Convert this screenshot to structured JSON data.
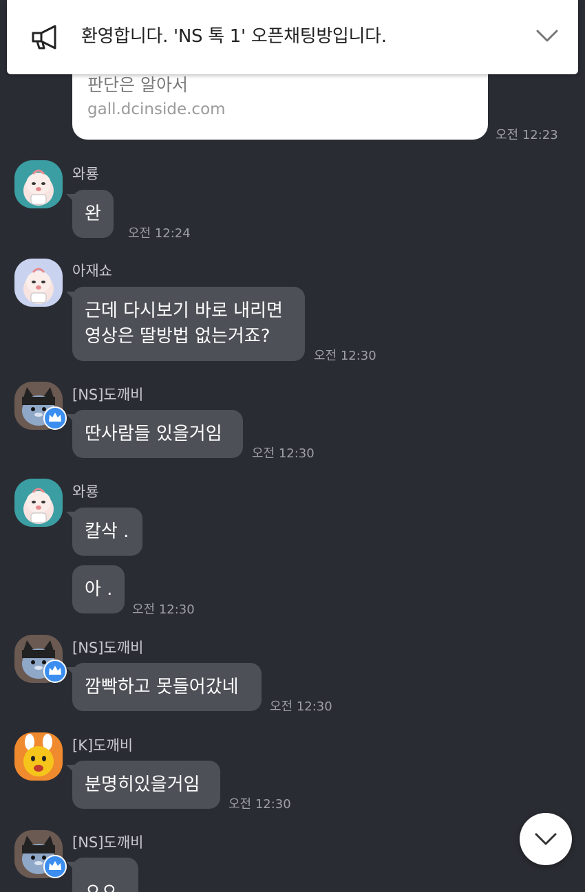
{
  "notice": {
    "text": "환영합니다. 'NS 톡 1' 오픈채팅방입니다.",
    "icon": "megaphone-icon",
    "toggle_icon": "chevron-down-icon"
  },
  "link_preview": {
    "title": "판단은 알아서",
    "domain": "gall.dcinside.com",
    "time": "오전 12:23"
  },
  "messages": [
    {
      "sender": "와룡",
      "avatar": "apeach-mint",
      "lines": [
        "완"
      ],
      "time": "오전 12:24"
    },
    {
      "sender": "아재쇼",
      "avatar": "apeach-lavender",
      "lines": [
        "근데 다시보기 바로 내리면",
        "영상은 딸방법 없는거죠?"
      ],
      "time": "오전 12:30"
    },
    {
      "sender": "[NS]도깨비",
      "avatar": "cat-host",
      "host_badge": "crown-icon",
      "lines": [
        "딴사람들 있을거임"
      ],
      "time": "오전 12:30"
    },
    {
      "sender": "와룡",
      "avatar": "apeach-mint",
      "lines": [
        "칼삭 ."
      ],
      "time": ""
    },
    {
      "sender": "와룡",
      "avatar": "",
      "lines": [
        "아 ."
      ],
      "time": "오전 12:30"
    },
    {
      "sender": "[NS]도깨비",
      "avatar": "cat-host",
      "host_badge": "crown-icon",
      "lines": [
        "깜빡하고 못들어갔네"
      ],
      "time": "오전 12:30"
    },
    {
      "sender": "[K]도깨비",
      "avatar": "muzi-orange",
      "lines": [
        "분명히있을거임"
      ],
      "time": "오전 12:30"
    },
    {
      "sender": "[NS]도깨비",
      "avatar": "cat-host",
      "host_badge": "crown-icon",
      "lines": [
        "ㅇㅇ"
      ],
      "time": ""
    }
  ],
  "scroll_button": {
    "icon": "chevron-down-icon"
  },
  "colors": {
    "background": "#2a2c33",
    "bubble": "#4e5057",
    "time_text": "#9ea0a6",
    "host_crown": "#3b8ef0"
  }
}
